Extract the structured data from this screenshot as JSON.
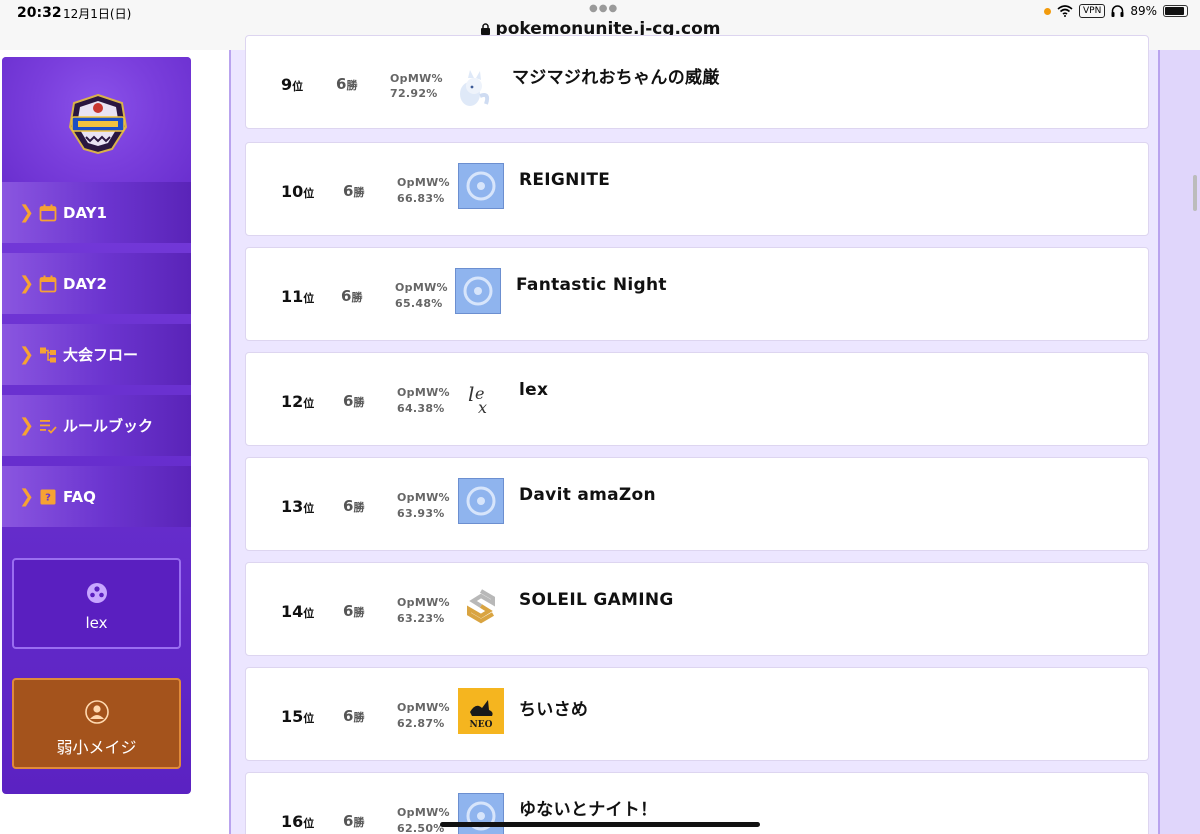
{
  "status_bar": {
    "time": "20:32",
    "date": "12月1日(日)",
    "url": "pokemonunite.j-cg.com",
    "vpn": "VPN",
    "battery": "89%",
    "battery_level": 0.89
  },
  "sidebar": {
    "logo_alt": "Pokémon UNITE Winter Tournament logo",
    "items": [
      {
        "label": "DAY1",
        "icon": "calendar-icon"
      },
      {
        "label": "DAY2",
        "icon": "calendar-icon"
      },
      {
        "label": "大会フロー",
        "icon": "flow-icon"
      },
      {
        "label": "ルールブック",
        "icon": "rulebook-icon"
      },
      {
        "label": "FAQ",
        "icon": "faq-icon"
      }
    ],
    "team_button": {
      "label": "lex",
      "icon": "team-icon"
    },
    "user_button": {
      "label": "弱小メイジ",
      "icon": "user-icon"
    }
  },
  "rankings": {
    "mw_label": "OpMW%",
    "rank_suffix": "位",
    "wins_suffix": "勝",
    "rows": [
      {
        "rank": "9",
        "wins": "6",
        "opmw": "72.92%",
        "team": "マジマジれおちゃんの威厳",
        "logo": "alolan-vulpix"
      },
      {
        "rank": "10",
        "wins": "6",
        "opmw": "66.83%",
        "team": "REIGNITE",
        "logo": "default"
      },
      {
        "rank": "11",
        "wins": "6",
        "opmw": "65.48%",
        "team": "Fantastic Night",
        "logo": "default"
      },
      {
        "rank": "12",
        "wins": "6",
        "opmw": "64.38%",
        "team": "lex",
        "logo": "lex"
      },
      {
        "rank": "13",
        "wins": "6",
        "opmw": "63.93%",
        "team": "Davit amaZon",
        "logo": "default"
      },
      {
        "rank": "14",
        "wins": "6",
        "opmw": "63.23%",
        "team": "SOLEIL GAMING",
        "logo": "soleil"
      },
      {
        "rank": "15",
        "wins": "6",
        "opmw": "62.87%",
        "team": "ちいさめ",
        "logo": "neo"
      },
      {
        "rank": "16",
        "wins": "6",
        "opmw": "62.50%",
        "team": "ゆないとナイト！",
        "logo": "default"
      }
    ]
  },
  "colors": {
    "sidebar_purple": "#6a31d0",
    "accent_orange": "#f6a233",
    "user_button": "#a4531c",
    "main_bg": "#ece6ff"
  }
}
